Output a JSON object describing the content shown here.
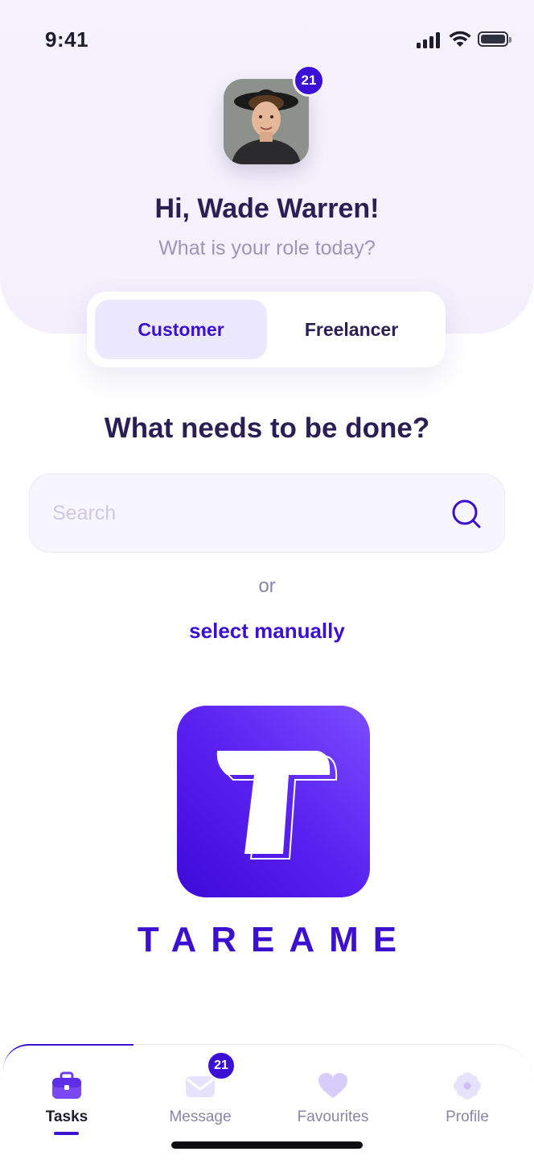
{
  "status_bar": {
    "time": "9:41"
  },
  "profile": {
    "notification_count": "21",
    "greeting": "Hi, Wade Warren!",
    "subtitle": "What is your role today?"
  },
  "role_toggle": {
    "options": [
      {
        "label": "Customer",
        "selected": true
      },
      {
        "label": "Freelancer",
        "selected": false
      }
    ]
  },
  "main": {
    "question": "What needs to be done?",
    "search_placeholder": "Search",
    "or_label": "or",
    "select_manually_label": "select manually"
  },
  "brand": {
    "name": "TAREAME",
    "color": "#3b10cf"
  },
  "bottom_nav": {
    "items": [
      {
        "label": "Tasks",
        "icon": "briefcase-icon",
        "active": true
      },
      {
        "label": "Message",
        "icon": "envelope-icon",
        "active": false,
        "badge": "21"
      },
      {
        "label": "Favourites",
        "icon": "heart-icon",
        "active": false
      },
      {
        "label": "Profile",
        "icon": "flower-icon",
        "active": false
      }
    ]
  },
  "colors": {
    "accent": "#3b10cf",
    "badge": "#3b0fd6",
    "heading": "#2a1f55",
    "muted": "#9d95b6"
  }
}
